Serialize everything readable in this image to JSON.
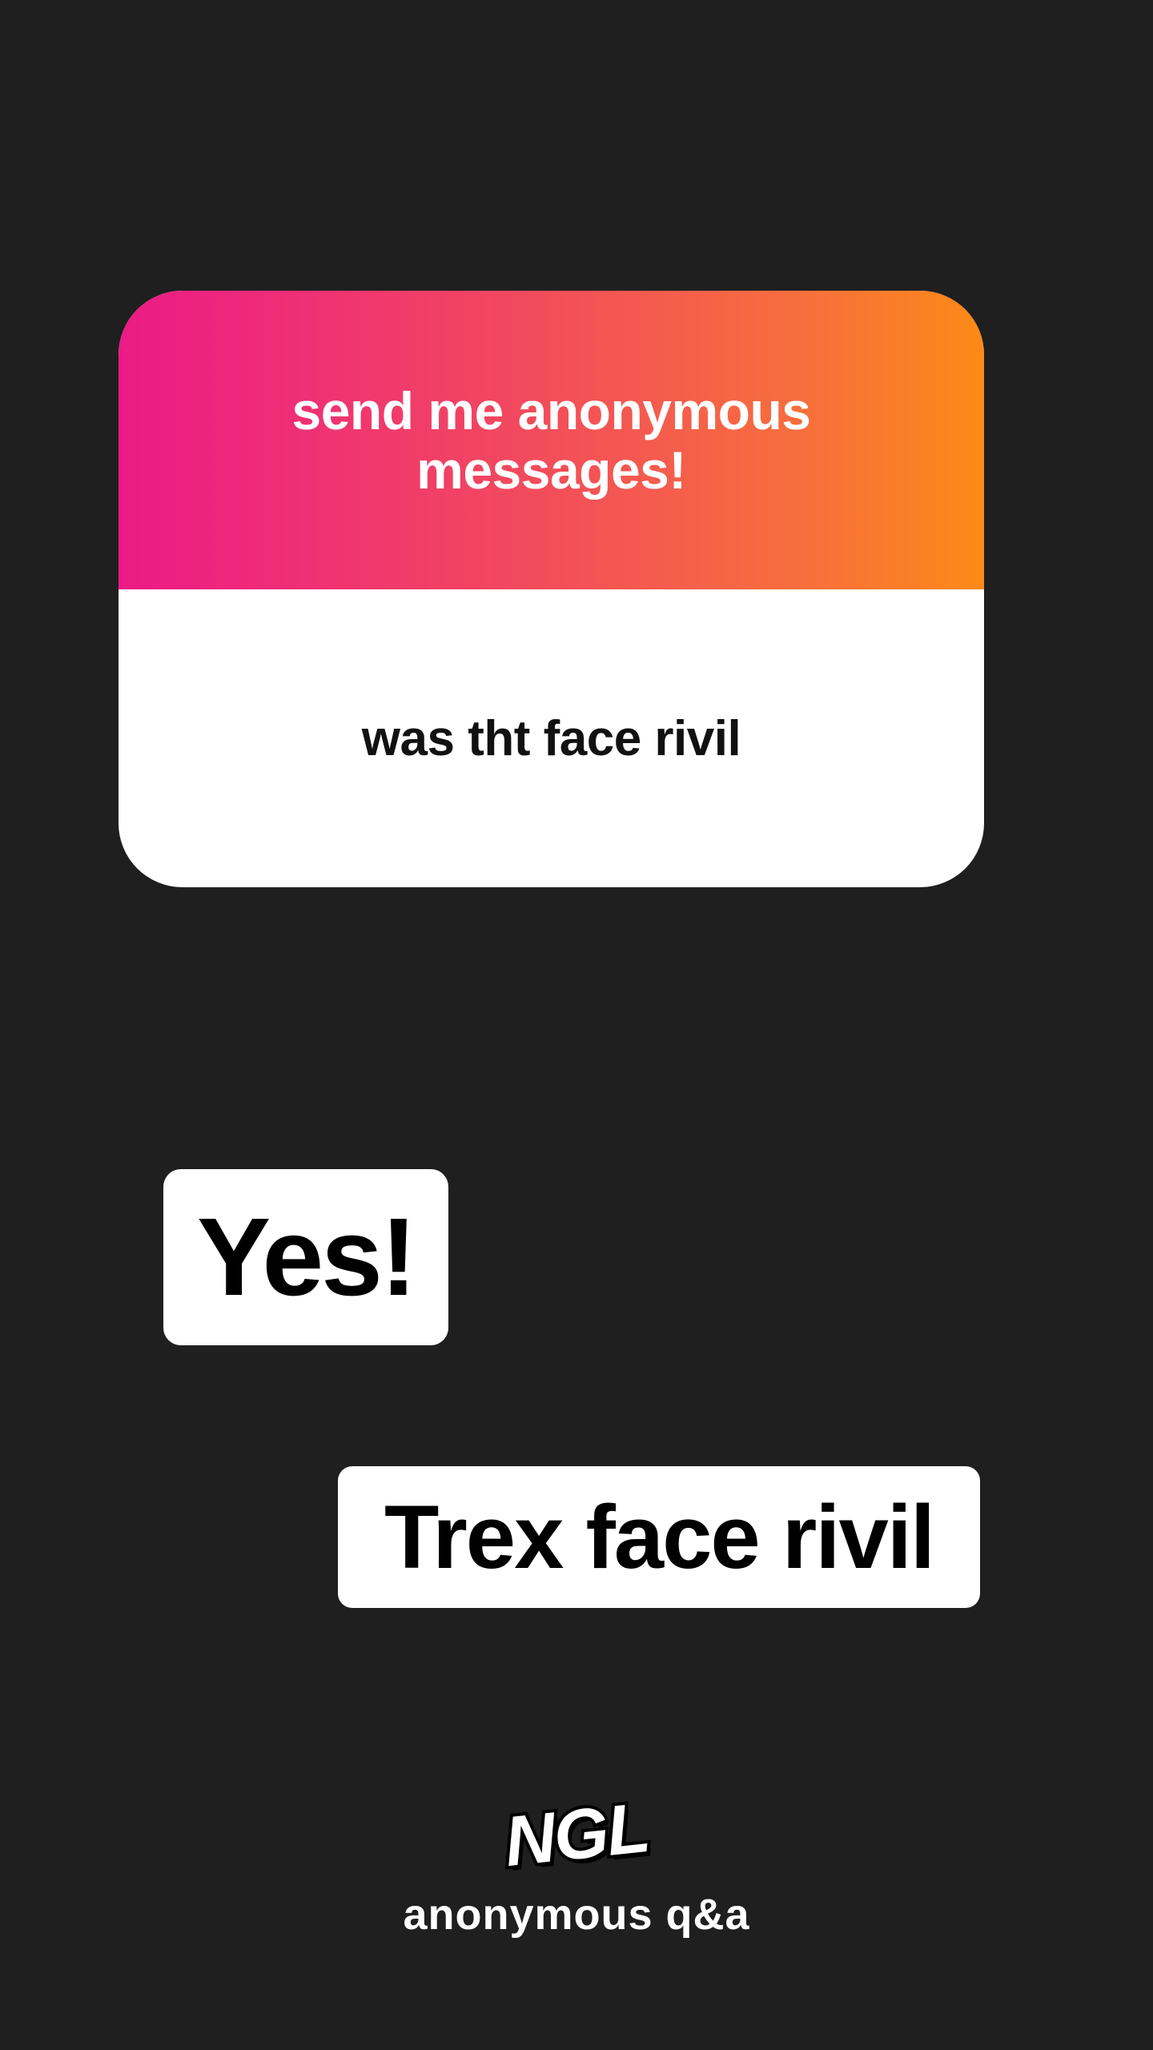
{
  "question_card": {
    "prompt": "send me anonymous messages!",
    "message": "was tht face rivil",
    "gradient_colors": [
      "#ec1a87",
      "#f2485f",
      "#f7703b",
      "#fd8a16"
    ]
  },
  "stickers": {
    "yes": "Yes!",
    "reply": "Trex face rivil"
  },
  "branding": {
    "logo": "NGL",
    "tagline": "anonymous q&a"
  },
  "colors": {
    "background": "#1f1f1f",
    "card_body": "#ffffff",
    "sticker_bg": "#ffffff"
  }
}
